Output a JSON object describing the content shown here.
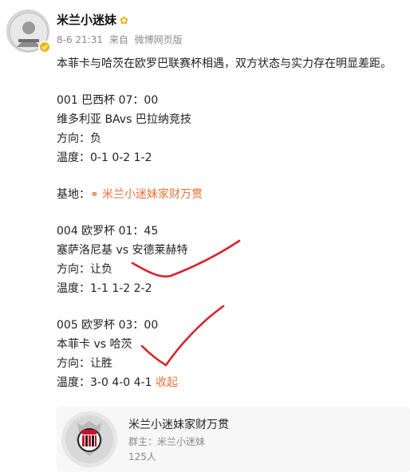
{
  "user": {
    "name": "米兰小迷妹",
    "badge_glyph": "✿",
    "post_date": "8-6 21:31",
    "source_prefix": "来自",
    "source": "微博网页版"
  },
  "post": {
    "intro": "本菲卡与哈茨在欧罗巴联赛杯相遇，双方状态与实力存在明显差距。",
    "match1": {
      "header": "001 巴西杯 07：00",
      "teams": "维多利亚 BAvs 巴拉纳竞技",
      "direction": "方向：负",
      "temperature": "温度：0-1 0-2 1-2"
    },
    "base_label": "基地：",
    "base_link": "米兰小迷妹家财万贯",
    "match2": {
      "header": "004 欧罗杯 01：45",
      "teams": "塞萨洛尼基 vs 安德莱赫特",
      "direction": "方向：让负",
      "temperature": "温度：1-1 1-2 2-2"
    },
    "match3": {
      "header": "005 欧罗杯 03：00",
      "teams": "本菲卡 vs 哈茨",
      "direction": "方向：让胜",
      "temperature": "温度：3-0 4-0 4-1"
    },
    "collapse_label": "收起"
  },
  "group_card": {
    "name": "米兰小迷妹家财万贯",
    "owner": "群主：米兰小迷妹",
    "member_count": "125人"
  },
  "colors": {
    "link_orange": "#e8703a",
    "annotation_red": "#d8232a",
    "meta_gray": "#8a8a8a"
  }
}
